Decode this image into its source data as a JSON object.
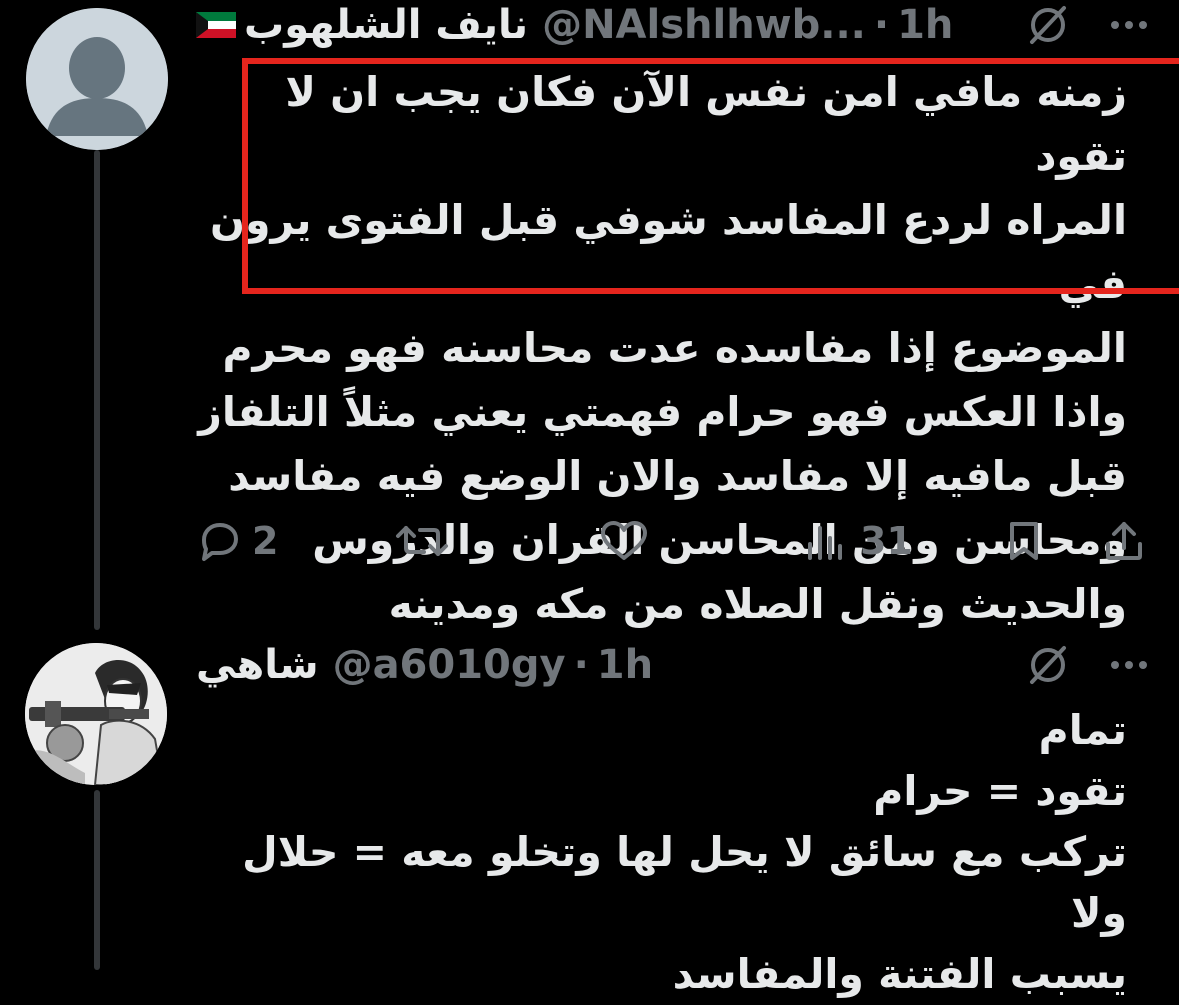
{
  "tweet1": {
    "display_name": "نايف الشلهوب",
    "handle": "@NAlshlhwb...",
    "separator": "·",
    "time": "1h",
    "text": "زمنه مافي امن نفس الآن فكان يجب ان لا تقود\nالمراه لردع المفاسد شوفي قبل الفتوى يرون في\nالموضوع إذا مفاسده عدت محاسنه فهو محرم\nواذا العكس فهو حرام فهمتي يعني مثلاً التلفاز\nقبل مافيه إلا مفاسد والان الوضع فيه مفاسد\nومحاسن ومن المحاسن القران والدروس\nوالحديث ونقل الصلاه من مكه ومدينه",
    "actions": {
      "replies": "2",
      "retweets": "",
      "likes": "",
      "views": "31"
    }
  },
  "tweet2": {
    "display_name": "شاهي",
    "handle": "@a6010gy",
    "separator": "·",
    "time": "1h",
    "text": "تمام\nتقود = حرام\nتركب مع سائق لا يحل لها وتخلو معه = حلال ولا\nيسبب الفتنة والمفاسد"
  },
  "colors": {
    "background": "#000000",
    "text_primary": "#e7e9ea",
    "text_secondary": "#71767b",
    "annotation_red": "#e5251d",
    "thread_line": "#333639"
  },
  "icons": {
    "grok": "grok-icon",
    "more": "more-icon",
    "reply": "reply-icon",
    "retweet": "retweet-icon",
    "like": "heart-icon",
    "views": "views-icon",
    "bookmark": "bookmark-icon",
    "share": "share-icon",
    "flag": "kuwait-flag-icon"
  }
}
